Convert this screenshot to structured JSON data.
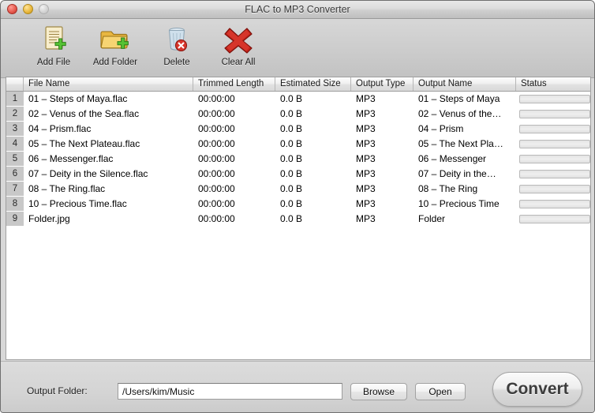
{
  "window": {
    "title": "FLAC to MP3 Converter",
    "controls": [
      {
        "name": "close",
        "color": "#e4564b"
      },
      {
        "name": "minimize",
        "color": "#e8b63a"
      },
      {
        "name": "zoom",
        "color": "#d2d2d2"
      }
    ]
  },
  "toolbar": {
    "items": [
      {
        "label": "Add File",
        "icon": "document-add-icon"
      },
      {
        "label": "Add Folder",
        "icon": "folder-add-icon"
      },
      {
        "label": "Delete",
        "icon": "trash-delete-icon"
      },
      {
        "label": "Clear All",
        "icon": "red-x-icon"
      }
    ]
  },
  "table": {
    "columns": [
      "",
      "File Name",
      "Trimmed Length",
      "Estimated Size",
      "Output Type",
      "Output Name",
      "Status"
    ],
    "rows": [
      {
        "num": "1",
        "file_name": "01 – Steps of Maya.flac",
        "trimmed_length": "00:00:00",
        "estimated_size": "0.0 B",
        "output_type": "MP3",
        "output_name": "01 – Steps of Maya",
        "status": ""
      },
      {
        "num": "2",
        "file_name": "02 – Venus of the Sea.flac",
        "trimmed_length": "00:00:00",
        "estimated_size": "0.0 B",
        "output_type": "MP3",
        "output_name": "02 – Venus of the…",
        "status": ""
      },
      {
        "num": "3",
        "file_name": "04 – Prism.flac",
        "trimmed_length": "00:00:00",
        "estimated_size": "0.0 B",
        "output_type": "MP3",
        "output_name": "04 – Prism",
        "status": ""
      },
      {
        "num": "4",
        "file_name": "05 – The Next Plateau.flac",
        "trimmed_length": "00:00:00",
        "estimated_size": "0.0 B",
        "output_type": "MP3",
        "output_name": "05 – The Next Pla…",
        "status": ""
      },
      {
        "num": "5",
        "file_name": "06 – Messenger.flac",
        "trimmed_length": "00:00:00",
        "estimated_size": "0.0 B",
        "output_type": "MP3",
        "output_name": "06 – Messenger",
        "status": ""
      },
      {
        "num": "6",
        "file_name": "07 – Deity in the Silence.flac",
        "trimmed_length": "00:00:00",
        "estimated_size": "0.0 B",
        "output_type": "MP3",
        "output_name": "07 – Deity in the…",
        "status": ""
      },
      {
        "num": "7",
        "file_name": "08 – The Ring.flac",
        "trimmed_length": "00:00:00",
        "estimated_size": "0.0 B",
        "output_type": "MP3",
        "output_name": "08 – The Ring",
        "status": ""
      },
      {
        "num": "8",
        "file_name": "10 – Precious Time.flac",
        "trimmed_length": "00:00:00",
        "estimated_size": "0.0 B",
        "output_type": "MP3",
        "output_name": "10 – Precious Time",
        "status": ""
      },
      {
        "num": "9",
        "file_name": "Folder.jpg",
        "trimmed_length": "00:00:00",
        "estimated_size": "0.0 B",
        "output_type": "MP3",
        "output_name": "Folder",
        "status": ""
      }
    ]
  },
  "footer": {
    "output_folder_label": "Output Folder:",
    "output_folder_value": "/Users/kim/Music",
    "output_folder_placeholder": "",
    "browse_label": "Browse",
    "open_label": "Open",
    "convert_label": "Convert"
  }
}
